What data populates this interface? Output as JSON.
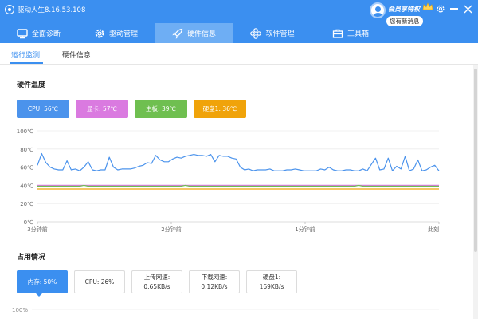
{
  "app": {
    "title": "驱动人生8.16.53.108"
  },
  "member": {
    "label": "会员享特权",
    "news": "您有新消息"
  },
  "nav": {
    "tabs": [
      {
        "label": "全面诊断",
        "icon": "monitor-icon"
      },
      {
        "label": "驱动管理",
        "icon": "gear-icon"
      },
      {
        "label": "硬件信息",
        "icon": "rocket-icon"
      },
      {
        "label": "软件管理",
        "icon": "apps-icon"
      },
      {
        "label": "工具箱",
        "icon": "toolbox-icon"
      }
    ],
    "active": "硬件信息"
  },
  "subtabs": {
    "items": [
      "运行监测",
      "硬件信息"
    ],
    "active": "运行监测"
  },
  "temperature": {
    "title": "硬件温度",
    "badges": [
      {
        "label": "CPU: 56℃",
        "color": "#4b93ec"
      },
      {
        "label": "显卡: 57℃",
        "color": "#da7ae0"
      },
      {
        "label": "主板: 39℃",
        "color": "#6fbf50"
      },
      {
        "label": "硬盘1: 36℃",
        "color": "#f0a30a"
      }
    ]
  },
  "usage": {
    "title": "占用情况",
    "cards": [
      {
        "line1": "内存: 50%",
        "line2": ""
      },
      {
        "line1": "CPU: 26%",
        "line2": ""
      },
      {
        "line1": "上传网速:",
        "line2": "0.65KB/s"
      },
      {
        "line1": "下载网速:",
        "line2": "0.12KB/s"
      },
      {
        "line1": "硬盘1:",
        "line2": "169KB/s"
      }
    ],
    "active": "内存: 50%",
    "chart_top_label": "100%"
  },
  "chart_data": {
    "type": "line",
    "title": "",
    "xlabel": "",
    "ylabel": "",
    "ylim": [
      0,
      100
    ],
    "y_ticks": [
      "0℃",
      "20℃",
      "40℃",
      "60℃",
      "80℃",
      "100℃"
    ],
    "x_ticks": [
      "3分钟前",
      "2分钟前",
      "1分钟前",
      "此刻"
    ],
    "grid": true,
    "series": [
      {
        "name": "CPU",
        "color": "#4b93ec",
        "values": [
          62,
          75,
          65,
          60,
          58,
          57,
          57,
          67,
          57,
          58,
          56,
          60,
          66,
          57,
          56,
          57,
          57,
          71,
          60,
          57,
          58,
          58,
          58,
          59,
          61,
          62,
          65,
          64,
          73,
          68,
          66,
          66,
          69,
          71,
          70,
          72,
          73,
          74,
          73,
          73,
          72,
          74,
          66,
          73,
          72,
          72,
          70,
          69,
          60,
          57,
          58,
          56,
          57,
          57,
          57,
          58,
          56,
          56,
          56,
          57,
          57,
          58,
          57,
          56,
          56,
          56,
          56,
          58,
          57,
          60,
          57,
          56,
          56,
          57,
          57,
          56,
          56,
          58,
          56,
          63,
          70,
          57,
          58,
          70,
          56,
          61,
          58,
          72,
          56,
          58,
          68,
          56,
          57,
          60,
          62,
          56
        ]
      },
      {
        "name": "显卡",
        "color": "#da7ae0",
        "values": [
          40,
          40,
          40,
          40,
          40,
          40,
          40,
          40,
          40,
          40,
          40,
          40,
          40,
          40,
          40,
          40,
          40,
          40,
          40,
          40,
          40,
          40,
          40,
          40,
          40,
          40,
          40,
          40,
          40,
          40,
          40,
          40,
          40,
          40,
          40,
          40,
          40,
          40,
          40,
          40,
          40,
          40,
          40,
          40,
          40,
          40,
          40,
          40,
          40,
          40,
          40,
          40,
          40,
          40,
          40,
          40,
          40,
          40,
          40,
          40,
          40,
          40,
          40,
          40,
          40,
          40,
          40,
          40,
          40,
          40,
          40,
          40,
          40,
          40,
          40,
          40,
          40,
          40,
          40,
          40,
          40,
          40,
          40,
          40,
          40,
          40,
          40,
          40,
          40,
          40,
          40,
          40,
          40,
          40,
          40,
          40
        ]
      },
      {
        "name": "主板",
        "color": "#6fbf50",
        "values": [
          39,
          39,
          39,
          39,
          39,
          39,
          39,
          39,
          39,
          39,
          39,
          40,
          39,
          39,
          39,
          39,
          39,
          39,
          39,
          39,
          39,
          39,
          39,
          39,
          39,
          39,
          39,
          39,
          39,
          39,
          39,
          39,
          39,
          39,
          39,
          40,
          39,
          39,
          39,
          39,
          39,
          39,
          39,
          39,
          39,
          39,
          39,
          39,
          39,
          39,
          39,
          39,
          39,
          39,
          39,
          39,
          39,
          39,
          39,
          39,
          39,
          39,
          39,
          39,
          39,
          39,
          39,
          39,
          39,
          39,
          39,
          39,
          39,
          39,
          39,
          39,
          40,
          39,
          39,
          39,
          39,
          39,
          39,
          39,
          39,
          39,
          39,
          39,
          39,
          39,
          39,
          39,
          39,
          39,
          39,
          39
        ]
      },
      {
        "name": "硬盘1",
        "color": "#f0a30a",
        "values": [
          36,
          36,
          36,
          36,
          36,
          36,
          36,
          36,
          36,
          36,
          36,
          36,
          36,
          36,
          36,
          36,
          36,
          36,
          36,
          36,
          36,
          36,
          36,
          36,
          36,
          36,
          36,
          36,
          36,
          36,
          36,
          36,
          36,
          36,
          36,
          36,
          36,
          36,
          36,
          36,
          36,
          36,
          36,
          36,
          36,
          36,
          36,
          36,
          36,
          36,
          36,
          36,
          36,
          36,
          36,
          36,
          36,
          36,
          36,
          36,
          36,
          36,
          36,
          36,
          36,
          36,
          36,
          36,
          36,
          36,
          36,
          36,
          36,
          36,
          36,
          36,
          36,
          36,
          36,
          36,
          36,
          36,
          36,
          36,
          36,
          36,
          36,
          36,
          36,
          36,
          36,
          36,
          36,
          36,
          36,
          36
        ]
      }
    ]
  }
}
